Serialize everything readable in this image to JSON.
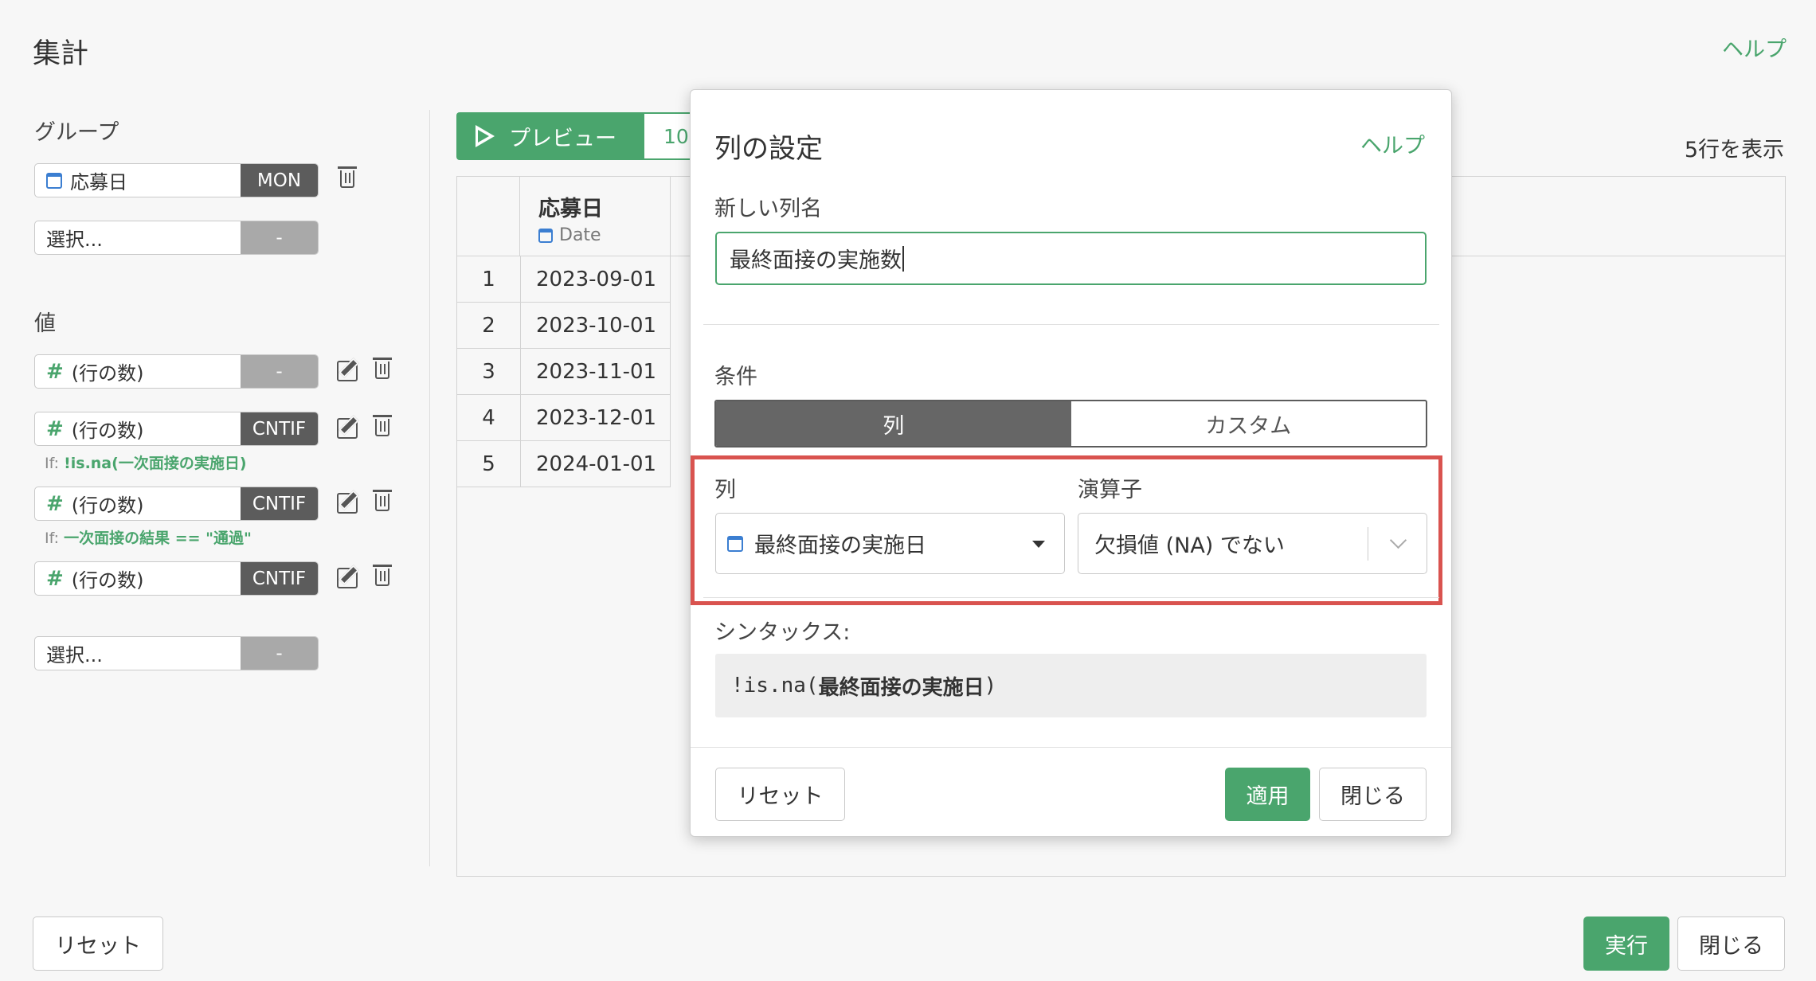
{
  "page": {
    "title": "集計",
    "help": "ヘルプ"
  },
  "group": {
    "label": "グループ",
    "fields": [
      {
        "name": "応募日",
        "tag": "MON",
        "icon": "calendar-icon"
      },
      {
        "name": "選択...",
        "tag": "-"
      }
    ]
  },
  "values": {
    "label": "値",
    "fields": [
      {
        "name": "(行の数)",
        "tag": "-",
        "icon": "hash-icon"
      },
      {
        "name": "(行の数)",
        "tag": "CNTIF",
        "icon": "hash-icon",
        "cond_prefix": "If:",
        "cond": "!is.na(一次面接の実施日)"
      },
      {
        "name": "(行の数)",
        "tag": "CNTIF",
        "icon": "hash-icon",
        "cond_prefix": "If:",
        "cond": "一次面接の結果 == \"通過\""
      },
      {
        "name": "(行の数)",
        "tag": "CNTIF",
        "icon": "hash-icon"
      },
      {
        "name": "選択...",
        "tag": "-"
      }
    ]
  },
  "preview": {
    "label": "プレビュー",
    "count": "10",
    "rows_shown": "5行を表示"
  },
  "table": {
    "column": {
      "name": "応募日",
      "type": "Date"
    },
    "rows": [
      {
        "n": "1",
        "v": "2023-09-01"
      },
      {
        "n": "2",
        "v": "2023-10-01"
      },
      {
        "n": "3",
        "v": "2023-11-01"
      },
      {
        "n": "4",
        "v": "2023-12-01"
      },
      {
        "n": "5",
        "v": "2024-01-01"
      }
    ]
  },
  "footer": {
    "reset": "リセット",
    "run": "実行",
    "close": "閉じる"
  },
  "modal": {
    "title": "列の設定",
    "help": "ヘルプ",
    "new_name_label": "新しい列名",
    "new_name_value": "最終面接の実施数",
    "condition_label": "条件",
    "tabs": [
      "列",
      "カスタム"
    ],
    "column_label": "列",
    "column_value": "最終面接の実施日",
    "operator_label": "演算子",
    "operator_value": "欠損値 (NA) でない",
    "syntax_label": "シンタックス:",
    "syntax_prefix": "!is.na(",
    "syntax_column": "最終面接の実施日",
    "syntax_suffix": ")",
    "reset": "リセット",
    "apply": "適用",
    "close": "閉じる"
  },
  "colors": {
    "accent": "#4aa56d",
    "highlight": "#d9534f",
    "tag_dark": "#5c5c5c",
    "tag_light": "#a9a9a9"
  }
}
